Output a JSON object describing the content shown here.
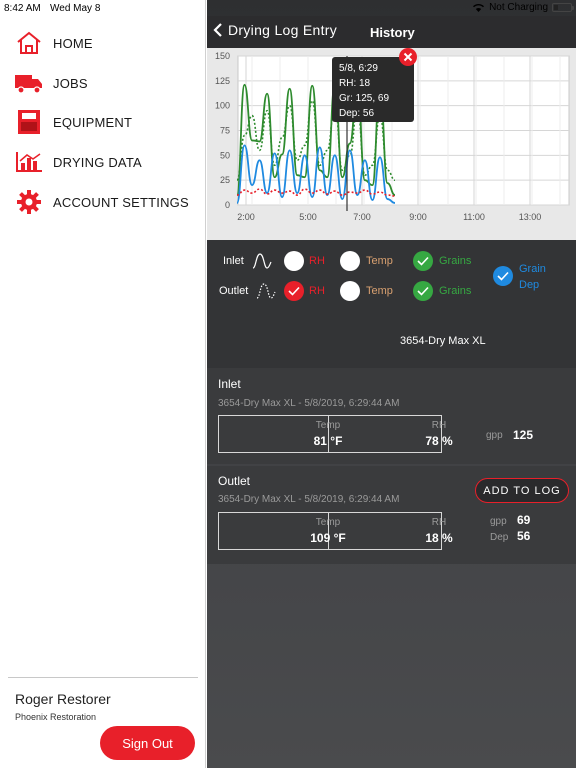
{
  "status_bar": {
    "time": "8:42 AM",
    "date": "Wed May 8",
    "battery_text": "Not Charging"
  },
  "sidebar": {
    "items": [
      {
        "label": "HOME",
        "icon": "home-icon"
      },
      {
        "label": "JOBS",
        "icon": "truck-icon"
      },
      {
        "label": "EQUIPMENT",
        "icon": "equipment-icon"
      },
      {
        "label": "DRYING DATA",
        "icon": "chart-icon"
      },
      {
        "label": "ACCOUNT SETTINGS",
        "icon": "gear-icon"
      }
    ],
    "user_name": "Roger Restorer",
    "company": "Phoenix Restoration",
    "signout_label": "Sign Out"
  },
  "header": {
    "back_label": "Drying Log Entry",
    "title": "History"
  },
  "chart_data": {
    "type": "line",
    "y_ticks": [
      "0",
      "25",
      "50",
      "75",
      "100",
      "125",
      "150"
    ],
    "x_ticks": [
      "2:00",
      "5:00",
      "7:00",
      "9:00",
      "11:00",
      "13:00"
    ],
    "ylim": [
      0,
      150
    ],
    "grid": true,
    "series": [
      {
        "color": "#2e8b2e",
        "style": "solid",
        "values": [
          10,
          121,
          65,
          64,
          112,
          28,
          51,
          117,
          30,
          28,
          120,
          35,
          28,
          121,
          28,
          62,
          118,
          25,
          20,
          120,
          22,
          10
        ]
      },
      {
        "color": "#2e8b2e",
        "style": "dotted",
        "values": [
          25,
          70,
          90,
          55,
          95,
          40,
          68,
          100,
          45,
          60,
          105,
          40,
          55,
          100,
          35,
          50,
          98,
          30,
          40,
          90,
          35,
          25
        ]
      },
      {
        "color": "#1f8ae0",
        "style": "solid",
        "values": [
          2,
          60,
          20,
          45,
          12,
          52,
          8,
          55,
          12,
          50,
          8,
          58,
          10,
          50,
          6,
          55,
          10,
          45,
          5,
          48,
          6,
          2
        ]
      },
      {
        "color": "#e8202a",
        "style": "dotted",
        "values": [
          10,
          15,
          12,
          16,
          11,
          15,
          12,
          14,
          10,
          16,
          12,
          15,
          11,
          14,
          10,
          13,
          12,
          15,
          11,
          13,
          10,
          9
        ]
      }
    ],
    "tooltip": {
      "line1": "5/8, 6:29",
      "line2": "RH: 18",
      "line3": "Gr: 125, 69",
      "line4": "Dep: 56"
    }
  },
  "legend": {
    "inlet_label": "Inlet",
    "outlet_label": "Outlet",
    "rh_label": "RH",
    "temp_label": "Temp",
    "grains_label": "Grains",
    "graindep_line1": "Grain",
    "graindep_line2": "Dep",
    "device_name": "3654-Dry Max XL"
  },
  "inlet": {
    "title": "Inlet",
    "subtitle": "3654-Dry Max XL - 5/8/2019, 6:29:44 AM",
    "temp_label": "Temp",
    "temp_value": "81 °F",
    "rh_label": "RH",
    "rh_value": "78 %",
    "gpp_label": "gpp",
    "gpp_value": "125"
  },
  "outlet": {
    "title": "Outlet",
    "subtitle": "3654-Dry Max XL - 5/8/2019, 6:29:44 AM",
    "temp_label": "Temp",
    "temp_value": "109 °F",
    "rh_label": "RH",
    "rh_value": "18 %",
    "gpp_label": "gpp",
    "gpp_value": "69",
    "dep_label": "Dep",
    "dep_value": "56"
  },
  "add_to_log_label": "ADD TO LOG"
}
